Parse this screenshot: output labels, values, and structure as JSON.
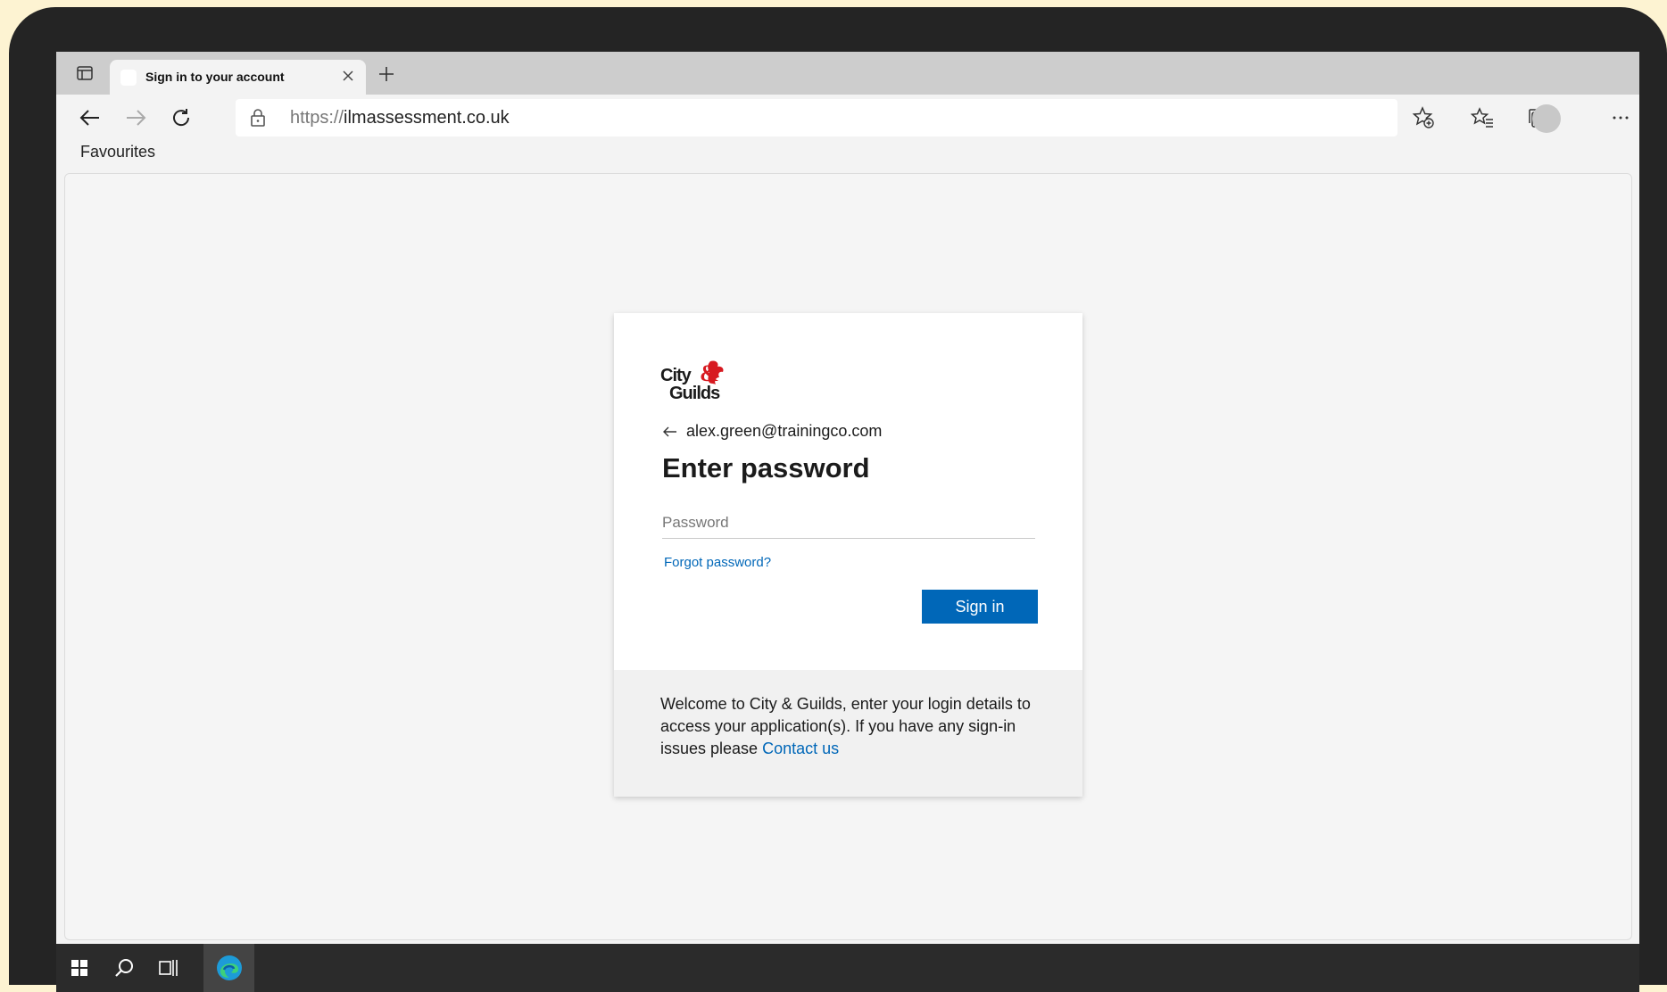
{
  "browser": {
    "tab_title": "Sign in to your account",
    "url_scheme": "https://",
    "url_host": "ilmassessment.co.uk",
    "favourites_label": "Favourites"
  },
  "signin": {
    "logo_text": [
      "City",
      "&",
      "Guilds"
    ],
    "email": "alex.green@trainingco.com",
    "heading": "Enter password",
    "password_placeholder": "Password",
    "password_value": "",
    "forgot_label": "Forgot password?",
    "signin_label": "Sign in",
    "welcome_text": "Welcome to City & Guilds, enter your login details to access your application(s). If you have any sign-in issues please",
    "contact_label": "Contact us"
  },
  "colors": {
    "accent": "#0067b8",
    "logo_red": "#d71920",
    "bezel": "#242424",
    "background": "#fdf3d2"
  },
  "icons": {
    "tab_actions": "tab-actions-icon",
    "close": "close-icon",
    "new_tab": "plus-icon",
    "back": "back-arrow-icon",
    "forward": "forward-arrow-icon",
    "refresh": "refresh-icon",
    "lock": "lock-icon",
    "add_favourite": "add-favourite-icon",
    "favourites": "favourites-icon",
    "collections": "collections-icon",
    "more": "more-icon",
    "start": "windows-start-icon",
    "search": "search-icon",
    "task_view": "task-view-icon",
    "edge": "edge-icon"
  }
}
